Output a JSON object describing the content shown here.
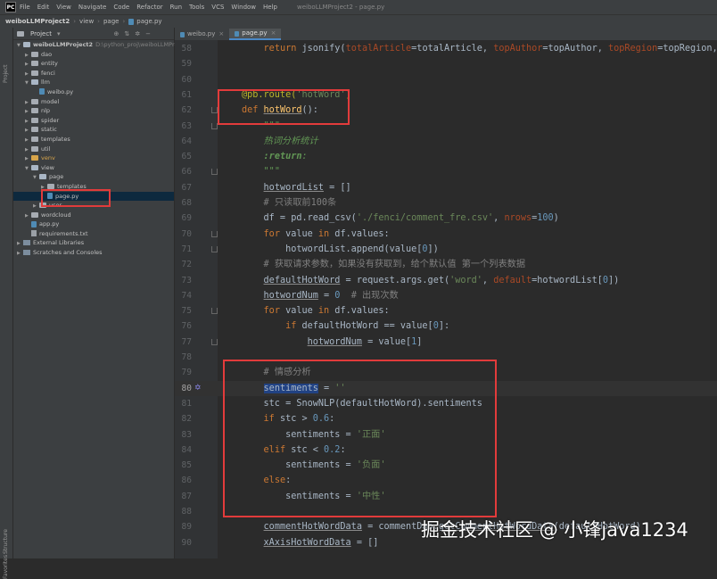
{
  "menubar": {
    "items": [
      "File",
      "Edit",
      "View",
      "Navigate",
      "Code",
      "Refactor",
      "Run",
      "Tools",
      "VCS",
      "Window",
      "Help"
    ],
    "window_title": "weiboLLMProject2 - page.py"
  },
  "navbar": {
    "project": "weiboLLMProject2",
    "crumbs": [
      "view",
      "page",
      "page.py"
    ]
  },
  "side_labels": {
    "project": "Project",
    "structure": "Structure",
    "favorites": "Favorites"
  },
  "project_panel": {
    "title": "Project",
    "tree": [
      {
        "label": "weiboLLMProject2",
        "path": "D:\\python_proj\\weiboLLMProje",
        "depth": 0,
        "type": "folder",
        "open": true
      },
      {
        "label": "dao",
        "depth": 1,
        "type": "folder"
      },
      {
        "label": "entity",
        "depth": 1,
        "type": "folder"
      },
      {
        "label": "fenci",
        "depth": 1,
        "type": "folder"
      },
      {
        "label": "llm",
        "depth": 1,
        "type": "folder",
        "open": true
      },
      {
        "label": "weibo.py",
        "depth": 2,
        "type": "py"
      },
      {
        "label": "model",
        "depth": 1,
        "type": "folder"
      },
      {
        "label": "nlp",
        "depth": 1,
        "type": "folder"
      },
      {
        "label": "spider",
        "depth": 1,
        "type": "folder"
      },
      {
        "label": "static",
        "depth": 1,
        "type": "folder"
      },
      {
        "label": "templates",
        "depth": 1,
        "type": "folder"
      },
      {
        "label": "util",
        "depth": 1,
        "type": "folder"
      },
      {
        "label": "venv",
        "depth": 1,
        "type": "folder",
        "orange": true
      },
      {
        "label": "view",
        "depth": 1,
        "type": "folder",
        "open": true
      },
      {
        "label": "page",
        "depth": 2,
        "type": "folder",
        "open": true
      },
      {
        "label": "templates",
        "depth": 3,
        "type": "folder"
      },
      {
        "label": "page.py",
        "depth": 3,
        "type": "py",
        "selected": true
      },
      {
        "label": "user",
        "depth": 2,
        "type": "folder"
      },
      {
        "label": "wordcloud",
        "depth": 1,
        "type": "folder"
      },
      {
        "label": "app.py",
        "depth": 1,
        "type": "py"
      },
      {
        "label": "requirements.txt",
        "depth": 1,
        "type": "txt"
      },
      {
        "label": "External Libraries",
        "depth": 0,
        "type": "lib"
      },
      {
        "label": "Scratches and Consoles",
        "depth": 0,
        "type": "lib"
      }
    ]
  },
  "tabs": [
    {
      "label": "weibo.py",
      "active": false
    },
    {
      "label": "page.py",
      "active": true
    }
  ],
  "editor": {
    "current_line": 80,
    "lines": [
      {
        "n": 58,
        "html": "    <span class=\"kw\">return</span> jsonify(<span class=\"param\">totalArticle</span>=totalArticle, <span class=\"param\">topAuthor</span>=topAuthor, <span class=\"param\">topRegion</span>=topRegion,"
      },
      {
        "n": 59,
        "html": ""
      },
      {
        "n": 60,
        "html": ""
      },
      {
        "n": 61,
        "html": "<span class=\"deco\">@pb.route(</span><span class=\"str\">'hotWord'</span><span class=\"deco\">)</span>"
      },
      {
        "n": 62,
        "html": "<span class=\"kw\">def</span> <span class=\"fn ul\">hotWord</span>():"
      },
      {
        "n": 63,
        "html": "    <span class=\"doc\">\"\"\"</span>"
      },
      {
        "n": 64,
        "html": "    <span class=\"doc\">热词分析统计</span>"
      },
      {
        "n": 65,
        "html": "    <span class=\"doc\"><b>:return</b>:</span>"
      },
      {
        "n": 66,
        "html": "    <span class=\"doc\">\"\"\"</span>"
      },
      {
        "n": 67,
        "html": "    <span class=\"ul\">hotwordList</span> = []"
      },
      {
        "n": 68,
        "html": "    <span class=\"cm\"># 只读取前100条</span>"
      },
      {
        "n": 69,
        "html": "    df = pd.read_csv(<span class=\"str\">'./fenci/comment_fre.csv'</span>, <span class=\"param\">nrows</span>=<span class=\"num\">100</span>)"
      },
      {
        "n": 70,
        "html": "    <span class=\"kw\">for</span> value <span class=\"kw\">in</span> df.values:"
      },
      {
        "n": 71,
        "html": "        hotwordList.append(value[<span class=\"num\">0</span>])"
      },
      {
        "n": 72,
        "html": "    <span class=\"cm\"># 获取请求参数，如果没有获取到，给个默认值 第一个列表数据</span>"
      },
      {
        "n": 73,
        "html": "    <span class=\"ul\">defaultHotWord</span> = request.args.get(<span class=\"str\">'word'</span>, <span class=\"param\">default</span>=hotwordList[<span class=\"num\">0</span>])"
      },
      {
        "n": 74,
        "html": "    <span class=\"ul\">hotwordNum</span> = <span class=\"num\">0</span>  <span class=\"cm\"># 出现次数</span>"
      },
      {
        "n": 75,
        "html": "    <span class=\"kw\">for</span> value <span class=\"kw\">in</span> df.values:"
      },
      {
        "n": 76,
        "html": "        <span class=\"kw\">if</span> defaultHotWord == value[<span class=\"num\">0</span>]:"
      },
      {
        "n": 77,
        "html": "            <span class=\"ul\">hotwordNum</span> = value[<span class=\"num\">1</span>]"
      },
      {
        "n": 78,
        "html": ""
      },
      {
        "n": 79,
        "html": "    <span class=\"cm\"># 情感分析</span>"
      },
      {
        "n": 80,
        "html": "    <span class=\"hl\">sentiments</span> = <span class=\"str\">''</span>"
      },
      {
        "n": 81,
        "html": "    stc = SnowNLP(defaultHotWord).sentiments"
      },
      {
        "n": 82,
        "html": "    <span class=\"kw\">if</span> stc &gt; <span class=\"num\">0.6</span>:"
      },
      {
        "n": 83,
        "html": "        sentiments = <span class=\"str\">'正面'</span>"
      },
      {
        "n": 84,
        "html": "    <span class=\"kw\">elif</span> stc &lt; <span class=\"num\">0.2</span>:"
      },
      {
        "n": 85,
        "html": "        sentiments = <span class=\"str\">'负面'</span>"
      },
      {
        "n": 86,
        "html": "    <span class=\"kw\">else</span>:"
      },
      {
        "n": 87,
        "html": "        sentiments = <span class=\"str\">'中性'</span>"
      },
      {
        "n": 88,
        "html": ""
      },
      {
        "n": 89,
        "html": "    <span class=\"ul\">commentHotWordData</span> = commentDao.<span class=\"ul\">getCommentHotWordData</span>(defaultHotWord)"
      },
      {
        "n": 90,
        "html": "    <span class=\"ul\">xAxisHotWordData</span> = []"
      }
    ]
  },
  "watermark": "掘金技术社区 @ 小锋java1234",
  "colors": {
    "highlight_box": "#e23b3b",
    "accent": "#4a88c7"
  }
}
